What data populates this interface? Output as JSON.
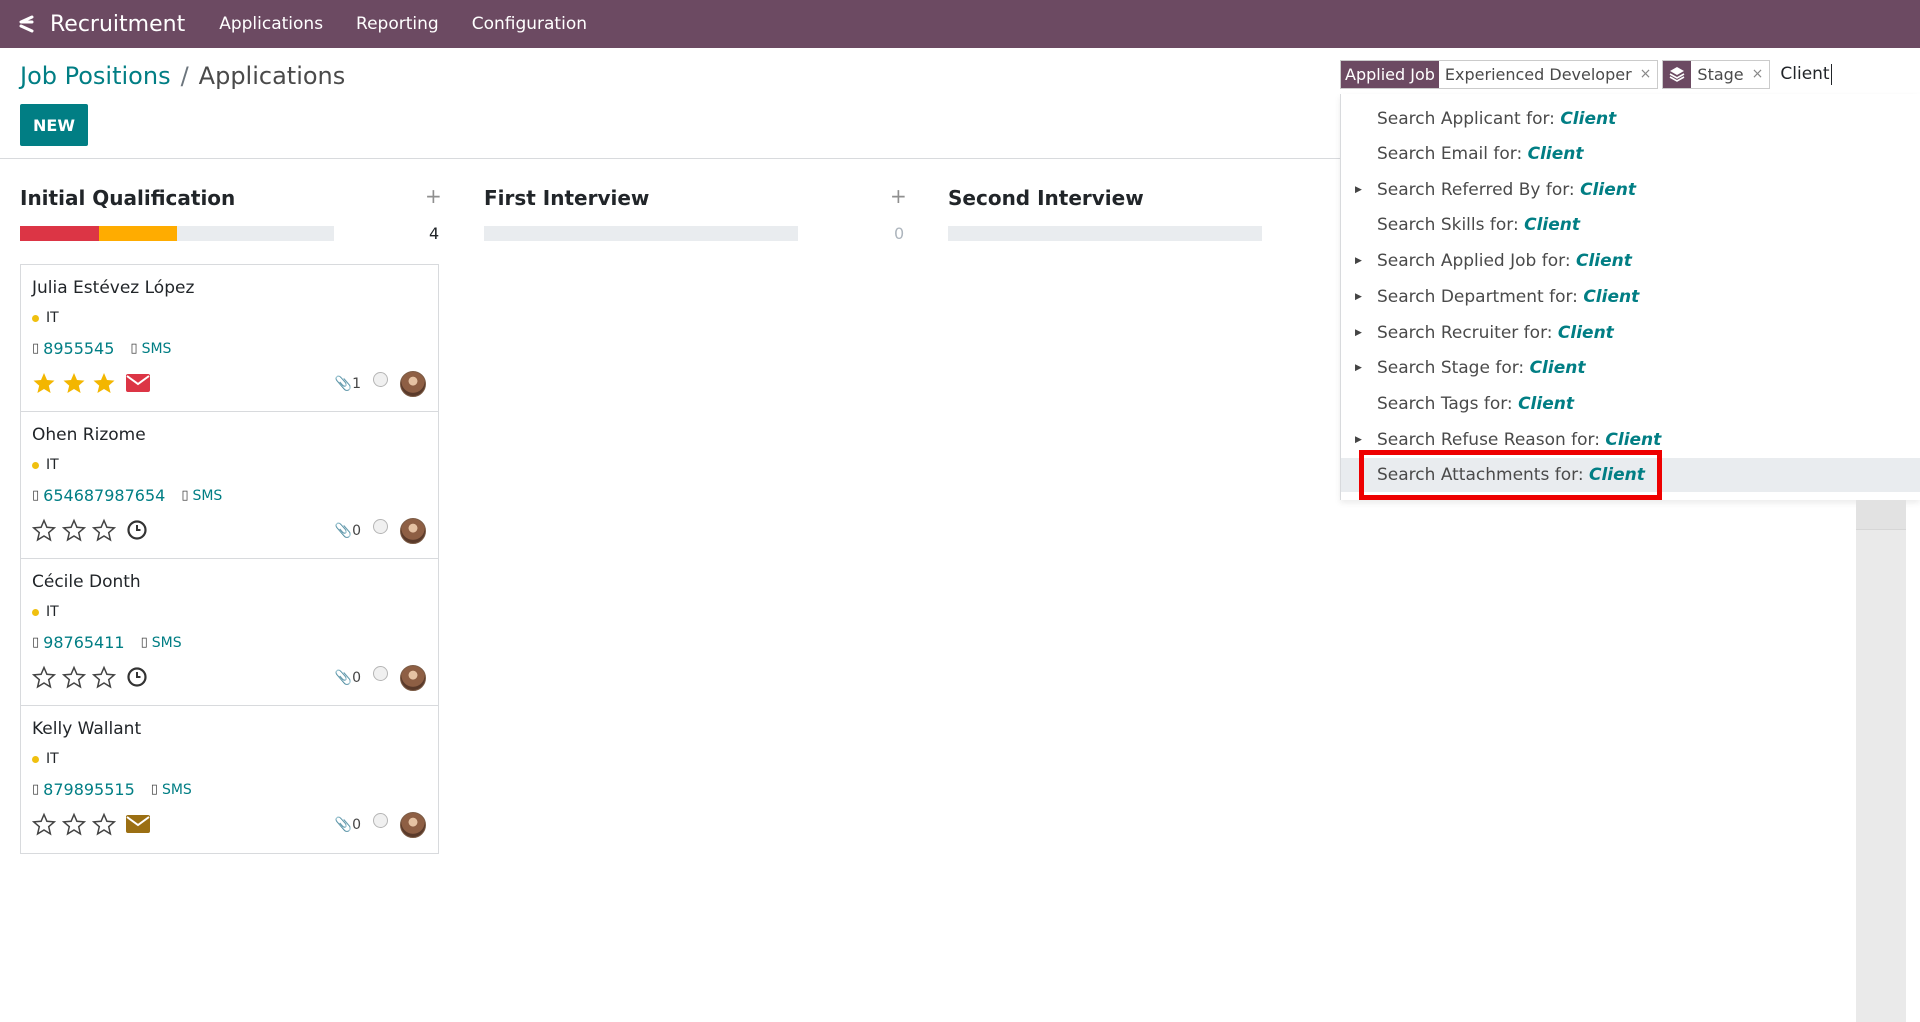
{
  "navbar": {
    "app_name": "Recruitment",
    "menus": [
      "Applications",
      "Reporting",
      "Configuration"
    ],
    "bg_color": "#6c4a62"
  },
  "breadcrumb": {
    "parent": "Job Positions",
    "separator": "/",
    "current": "Applications"
  },
  "control_panel": {
    "new_label": "NEW"
  },
  "search": {
    "facets": [
      {
        "label": "Applied Job",
        "value": "Experienced Developer",
        "close": "×"
      },
      {
        "icon": "layers-icon",
        "value": "Stage",
        "close": "×"
      }
    ],
    "query": "Client"
  },
  "autocomplete": {
    "items": [
      {
        "prefix": "Search ",
        "field": "Applicant",
        "mid": " for: ",
        "query": "Client",
        "expandable": false
      },
      {
        "prefix": "Search ",
        "field": "Email",
        "mid": " for: ",
        "query": "Client",
        "expandable": false
      },
      {
        "prefix": "Search ",
        "field": "Referred By",
        "mid": " for: ",
        "query": "Client",
        "expandable": true
      },
      {
        "prefix": "Search ",
        "field": "Skills",
        "mid": " for: ",
        "query": "Client",
        "expandable": false
      },
      {
        "prefix": "Search ",
        "field": "Applied Job",
        "mid": " for: ",
        "query": "Client",
        "expandable": true
      },
      {
        "prefix": "Search ",
        "field": "Department",
        "mid": " for: ",
        "query": "Client",
        "expandable": true
      },
      {
        "prefix": "Search ",
        "field": "Recruiter",
        "mid": " for: ",
        "query": "Client",
        "expandable": true
      },
      {
        "prefix": "Search ",
        "field": "Stage",
        "mid": " for: ",
        "query": "Client",
        "expandable": true
      },
      {
        "prefix": "Search ",
        "field": "Tags",
        "mid": " for: ",
        "query": "Client",
        "expandable": false
      },
      {
        "prefix": "Search ",
        "field": "Refuse Reason",
        "mid": " for: ",
        "query": "Client",
        "expandable": true
      },
      {
        "prefix": "Search ",
        "field": "Attachments",
        "mid": " for: ",
        "query": "Client",
        "expandable": false,
        "active": true
      }
    ],
    "highlight_color": "#ee0000"
  },
  "columns": [
    {
      "title": "Initial Qualification",
      "count": "4",
      "progress": {
        "red": 0.25,
        "orange": 0.25
      }
    },
    {
      "title": "First Interview",
      "count": "0"
    },
    {
      "title": "Second Interview"
    }
  ],
  "cards": [
    {
      "name": "Julia Estévez López",
      "tag": "IT",
      "phone": "8955545",
      "sms": "SMS",
      "stars": 3,
      "activity": "envelope-red",
      "attachments": "1"
    },
    {
      "name": "Ohen Rizome",
      "tag": "IT",
      "phone": "654687987654",
      "sms": "SMS",
      "stars": 0,
      "activity": "clock",
      "attachments": "0"
    },
    {
      "name": "Cécile Donth",
      "tag": "IT",
      "phone": "98765411",
      "sms": "SMS",
      "stars": 0,
      "activity": "clock",
      "attachments": "0"
    },
    {
      "name": "Kelly Wallant",
      "tag": "IT",
      "phone": "879895515",
      "sms": "SMS",
      "stars": 0,
      "activity": "envelope-brown",
      "attachments": "0"
    }
  ],
  "colors": {
    "accent": "#017e84",
    "star": "#f3b600",
    "red": "#dc3545",
    "orange": "#ffac00",
    "brown": "#9b6f13"
  }
}
